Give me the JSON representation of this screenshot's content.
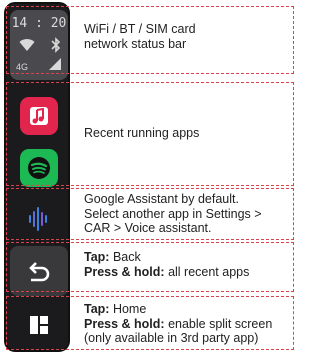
{
  "sidebar": {
    "clock": "14 : 20",
    "network_type": "4G"
  },
  "annotations": {
    "status_bar": {
      "line1": "WiFi / BT / SIM card",
      "line2": "network status bar"
    },
    "recent_apps": {
      "line1": "Recent running apps"
    },
    "assistant": {
      "line1": "Google Assistant by default.",
      "line2": "Select another app in Settings >",
      "line3": "CAR > Voice assistant."
    },
    "back": {
      "tap_label": "Tap:",
      "tap_action": "Back",
      "hold_label": "Press & hold:",
      "hold_action": "all recent apps"
    },
    "home": {
      "tap_label": "Tap:",
      "tap_action": "Home",
      "hold_label": "Press & hold:",
      "hold_action": "enable split screen",
      "note": "(only available in 3rd party app)"
    }
  },
  "colors": {
    "annotation_border": "#d9434e",
    "music_app": "#e1254d",
    "spotify_app": "#1db954",
    "assistant_icon": "#3a82e0"
  }
}
